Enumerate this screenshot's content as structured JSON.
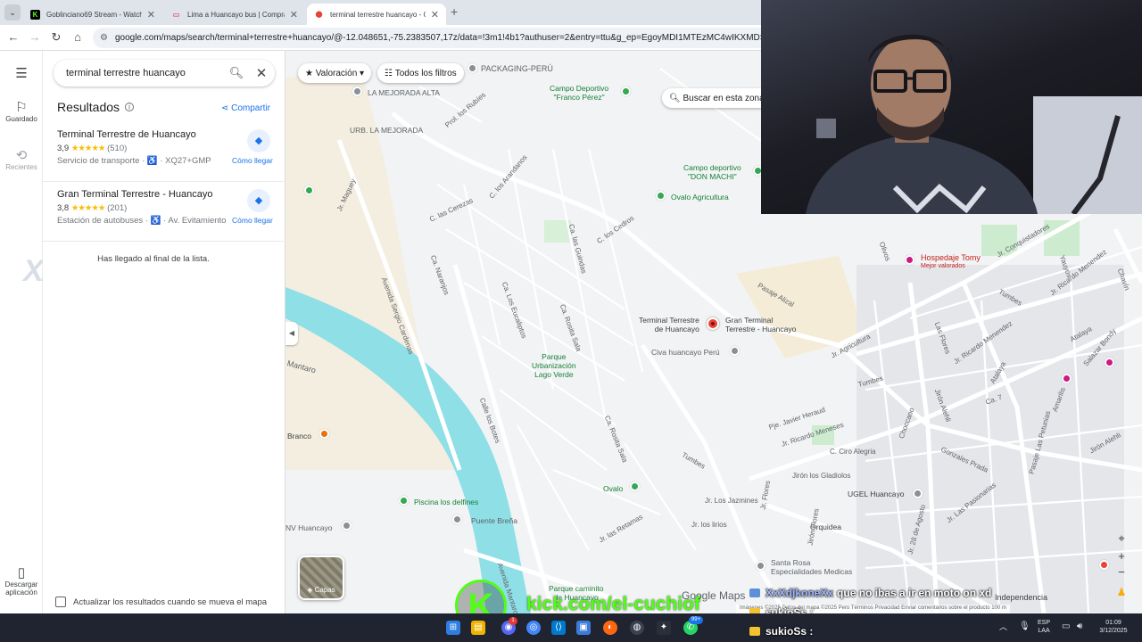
{
  "browser": {
    "tabs": [
      {
        "title": "Goblinciano69 Stream - Watch",
        "favicon_color": "#53fc18",
        "favicon_glyph": "K",
        "active": false
      },
      {
        "title": "Lima a Huancayo bus | Compra",
        "favicon_color": "#e05a8a",
        "favicon_glyph": "▭",
        "active": false
      },
      {
        "title": "terminal terrestre huancayo - G",
        "favicon_color": "#ea4335",
        "favicon_glyph": "⬤",
        "active": true
      }
    ],
    "url": "google.com/maps/search/terminal+terrestre+huancayo/@-12.048651,-75.2383507,17z/data=!3m1!4b1?authuser=2&entry=ttu&g_ep=EgoyMDI1MTEzMC4wIKXMDSoASAFQAw"
  },
  "rail": {
    "saved_label": "Guardado",
    "recent_label": "Recientes",
    "download_label": "Descargar aplicación"
  },
  "panel": {
    "search_query": "terminal terrestre huancayo",
    "results_title": "Resultados",
    "share_label": "Compartir",
    "results": [
      {
        "name": "Terminal Terrestre de Huancayo",
        "rating": "3,9",
        "stars": "★★★★★",
        "count": "(510)",
        "category": "Servicio de transporte",
        "address": "XQ27+GMP",
        "directions": "Cómo llegar"
      },
      {
        "name": "Gran Terminal Terrestre - Huancayo",
        "rating": "3,8",
        "stars": "★★★★★",
        "count": "(201)",
        "category": "Estación de autobuses",
        "address": "Av. Evitamiento",
        "directions": "Cómo llegar"
      }
    ],
    "end_of_list": "Has llegado al final de la lista.",
    "update_on_move": "Actualizar los resultados cuando se mueva el mapa"
  },
  "map": {
    "filter_rating": "Valoración",
    "filter_all": "Todos los filtros",
    "search_this_area": "Buscar en esta zona",
    "layers_label": "Capas",
    "brand": "Google Maps",
    "footer": "Imágenes ©2025 Datos del mapa ©2025   Perú   Términos   Privacidad   Enviar comentarios sobre el producto   100 m",
    "pois": {
      "packaging": "PACKAGING-PERÚ",
      "mejorada_alta": "LA MEJORADA ALTA",
      "urb_mejorada": "URB. LA MEJORADA",
      "franco_perez": "Campo Deportivo\n\"Franco Pérez\"",
      "don_machi": "Campo deportivo\n\"DON MACHI\"",
      "ovalo_agri": "Ovalo Agricultura",
      "hospedaje": "Hospedaje Tomy",
      "hospedaje_sub": "Mejor valorados",
      "terminal": "Terminal Terrestre\nde Huancayo",
      "gran_terminal": "Gran Terminal\nTerrestre - Huancayo",
      "civa": "Civa huancayo Perú",
      "parque_lago": "Parque\nUrbanización\nLago Verde",
      "branco": "Branco",
      "piscina": "Piscina los delfines",
      "puente": "Puente Breña",
      "nv_huancayo": "NV Huancayo",
      "ovalo": "Ovalo",
      "ugel": "UGEL Huancayo",
      "orquidea": "Orquidea",
      "santa_rosa": "Santa Rosa\nEspecialidades Medicas",
      "caminito": "Parque caminito\nde Huancayo",
      "independencia": "Independencia"
    },
    "streets": {
      "maguey": "Jr. Maguey",
      "sergio": "Avenida Sergio Cardenas",
      "rubies": "Prol. los Rubíes",
      "cerezas": "C. las Cerezas",
      "arandanos": "C. los Arandanos",
      "guindas": "Ca. las Guindas",
      "cedros": "C. los Cedros",
      "naranjos": "Ca. Naranjos",
      "eucaliptos": "Ca. Los Eucaliptos",
      "rosita": "Ca. Rosita Sala",
      "rosita2": "Ca. Rosita Sala",
      "botes": "Calle los Botes",
      "mantaro": "Mantaro",
      "av_mantaro": "Avenida Mantaro",
      "retamas": "Jr. las Retamas",
      "jazmines": "Jr. Los Jazmines",
      "lirios": "Jr. los lirios",
      "gladiolos": "Jirón los Gladiolos",
      "alizal": "Pasaje Alizal",
      "agricultura": "Jr. Agricultura",
      "ricardo": "Jr. Ricardo Menendez",
      "ricardo2": "Jr. Ricardo Menendez",
      "flores": "Las Flores",
      "alehli": "Jirón Alehli",
      "alehli2": "Jirón Alehli",
      "atalaya": "Atalaya",
      "atalaya2": "Atalaya",
      "javier": "Pje. Javier Heraud",
      "meneses": "Jr. Ricardo Meneses",
      "ogiera": "C. Ciro Alegria",
      "tumbes": "Tumbes",
      "tumbes2": "Tumbes",
      "tumbes3": "Tumbes",
      "choccano": "Choccano",
      "gonzales": "Gonzales Prada",
      "pasionarias": "Jr. Las Pasionarias",
      "petunias": "Pasaje Las Petunias",
      "agosto": "Jr. 28 de Agosto",
      "flores2": "Jr. Flores",
      "jflores": "Jirón Flores",
      "amarilis": "Amarilis",
      "conquistadores": "Jr. Conquistadores",
      "olivos": "Olivos",
      "yauyos": "Yauyos",
      "salazar": "Salazar Bondy",
      "chavin": "Chavín",
      "ca7": "Ca. 7"
    }
  },
  "stream": {
    "kick_url": "kick.com/el-cuchiof",
    "chat": [
      {
        "user": "XxXdjkoneXx",
        "message": "que no ibas a ir en moto on xd"
      },
      {
        "user": "sukioSs :",
        "message": ""
      },
      {
        "user": "sukioSs :",
        "message": ""
      }
    ]
  },
  "taskbar": {
    "lang": "ESP",
    "lang2": "LAA",
    "time": "01:09",
    "date": "3/12/2025",
    "badge_discord": "1",
    "badge_whatsapp": "99+"
  }
}
